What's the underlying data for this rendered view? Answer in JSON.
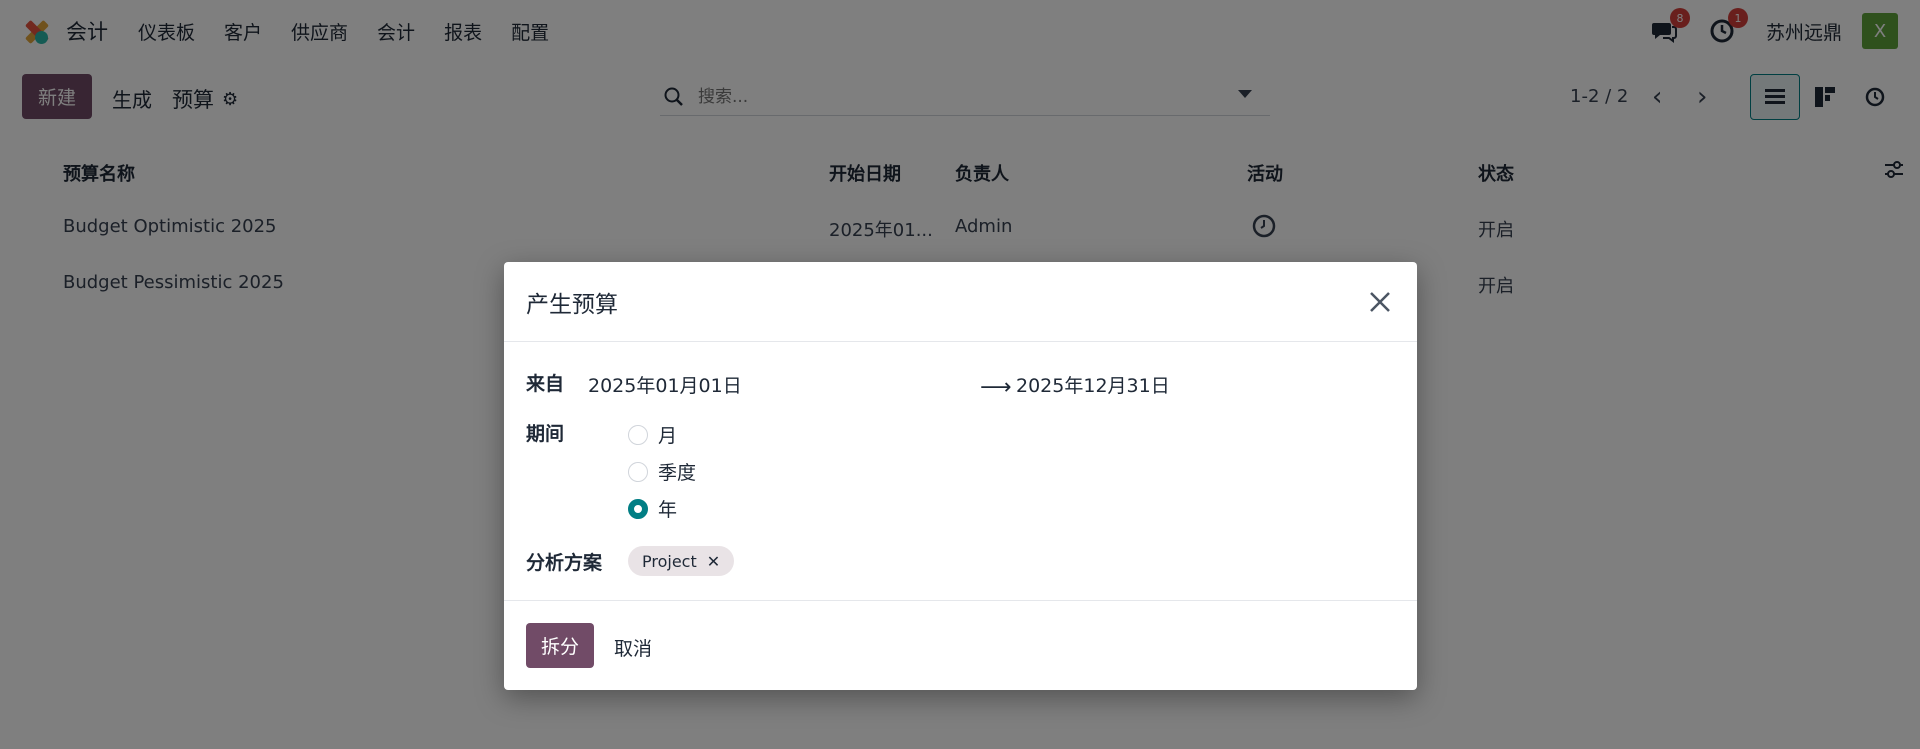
{
  "navbar": {
    "app_name": "会计",
    "menu": [
      "仪表板",
      "客户",
      "供应商",
      "会计",
      "报表",
      "配置"
    ],
    "messages_count": "8",
    "activities_count": "1",
    "company": "苏州远鼎",
    "avatar_initial": "X"
  },
  "control_panel": {
    "new_label": "新建",
    "generate_label": "生成",
    "title": "预算",
    "search_placeholder": "搜索...",
    "pager": "1-2 / 2"
  },
  "list": {
    "headers": {
      "name": "预算名称",
      "start_date": "开始日期",
      "responsible": "负责人",
      "activity": "活动",
      "state": "状态"
    },
    "rows": [
      {
        "name": "Budget Optimistic 2025",
        "start_date": "2025年01...",
        "responsible": "Admin",
        "state": "开启"
      },
      {
        "name": "Budget Pessimistic 2025",
        "start_date": "",
        "responsible": "",
        "state": "开启"
      }
    ]
  },
  "modal": {
    "title": "产生预算",
    "from_label": "来自",
    "date_from": "2025年01月01日",
    "date_to": "2025年12月31日",
    "period_label": "期间",
    "period_options": [
      "月",
      "季度",
      "年"
    ],
    "period_selected": "年",
    "plan_label": "分析方案",
    "plan_tag": "Project",
    "primary_button": "拆分",
    "cancel_button": "取消"
  },
  "colors": {
    "brand": "#714b67",
    "accent": "#017e84",
    "badge": "#d23f3a",
    "avatar": "#5fa33b"
  }
}
